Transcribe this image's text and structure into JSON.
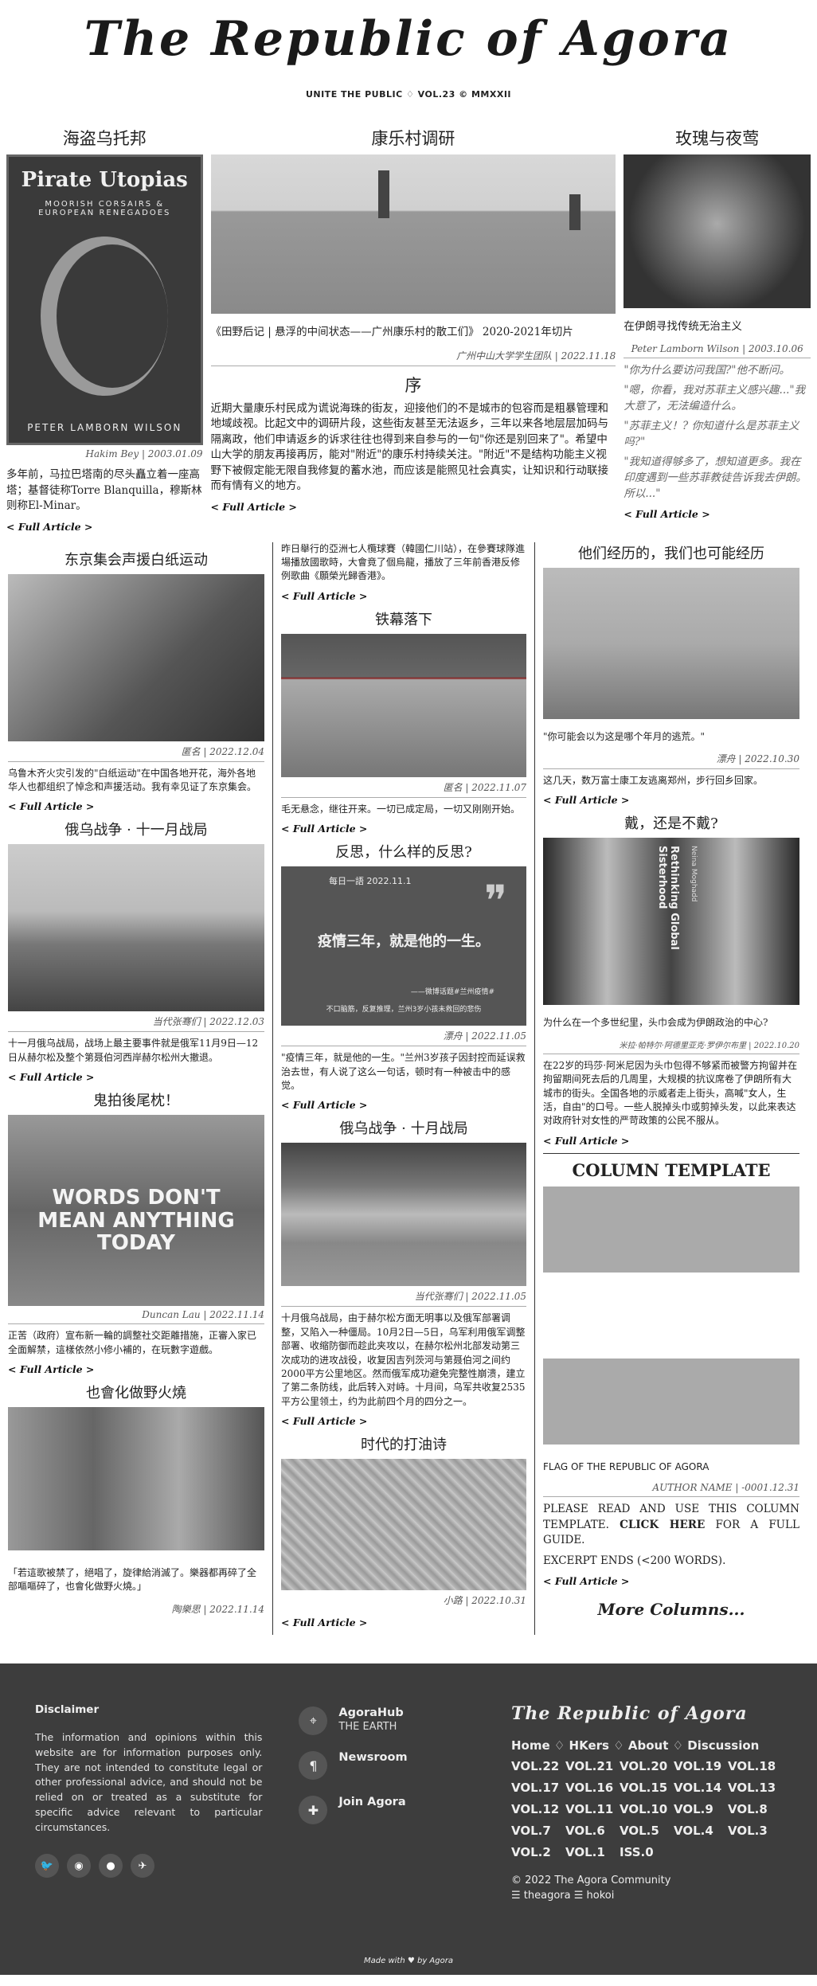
{
  "masthead": {
    "title": "The Republic of Agora",
    "subtitle": "UNITE THE PUBLIC ♢ VOL.23 © MMXXII"
  },
  "top": {
    "left": {
      "title": "海盗乌托邦",
      "image_text": "Pirate Utopias",
      "image_sub": "MOORISH CORSAIRS & EUROPEAN RENEGADOES",
      "image_author": "PETER LAMBORN WILSON",
      "byline": "Hakim Bey | 2003.01.09",
      "text": "多年前，马拉巴塔南的尽头矗立着一座高塔；基督徒称Torre Blanquilla，穆斯林则称El-Minar。",
      "more": "< Full Article >"
    },
    "center": {
      "title": "康乐村调研",
      "caption": "《田野后记 | 悬浮的中间状态——广州康乐村的散工们》 2020-2021年切片",
      "byline": "广州中山大学学生团队 | 2022.11.18",
      "subtitle": "序",
      "text": "近期大量康乐村民成为谎说海珠的街友，迎接他们的不是城市的包容而是粗暴管理和地域歧视。比起文中的调研片段，这些街友甚至无法返乡，三年以来各地层层加码与隔离政，他们申请返乡的诉求往往也得到来自参与的一句\"你还是别回来了\"。希望中山大学的朋友再接再厉，能对\"附近\"的康乐村持续关注。\"附近\"不是结构功能主义视野下被假定能无限自我修复的蓄水池，而应该是能照见社会真实，让知识和行动联接而有情有义的地方。",
      "more": "< Full Article >"
    },
    "right": {
      "title": "玫瑰与夜莺",
      "caption": "在伊朗寻找传统无治主义",
      "byline": "Peter Lamborn Wilson | 2003.10.06",
      "quotes": [
        "\"你为什么要访问我国?\"他不断问。",
        "\"嗯，你看，我对苏菲主义感兴趣...\"我大意了，无法编造什么。",
        "\"苏菲主义！? 你知道什么是苏菲主义吗?\"",
        "\"我知道得够多了，想知道更多。我在印度遇到一些苏菲教徒告诉我去伊朗。所以...\""
      ],
      "more": "< Full Article >"
    }
  },
  "articles": {
    "a1": {
      "title": "东京集会声援白纸运动",
      "byline": "匿名 | 2022.12.04",
      "text": "乌鲁木齐火灾引发的\"白纸运动\"在中国各地开花，海外各地华人也都组织了悼念和声援活动。我有幸见证了东京集会。",
      "more": "< Full Article >"
    },
    "a2": {
      "title": "俄乌战争 · 十一月战局",
      "byline": "当代张骞们 | 2022.12.03",
      "text": "十一月俄乌战局，战场上最主要事件就是俄军11月9日—12日从赫尔松及整个第聂伯河西岸赫尔松州大撤退。",
      "more": "< Full Article >"
    },
    "a3": {
      "title": "鬼拍後尾枕！",
      "image_text": "WORDS DON'T MEAN ANYTHING TODAY",
      "byline": "Duncan Lau | 2022.11.14",
      "text": "正苦（政府）宣布新一輪的調整社交距離措施，正審入家已全面解禁，這樣依然小修小補的，在玩數字遊戲。",
      "more": "< Full Article >"
    },
    "a4": {
      "title": "也會化做野火燒",
      "byline": "陶樂思 | 2022.11.14",
      "text": "「若這歌被禁了，絕唱了，旋律給消滅了。樂器都再碎了全部嘔嘔碎了，也會化做野火燒。」"
    },
    "b0": {
      "text": "昨日舉行的亞洲七人欖球賽（韓國仁川站），在參賽球隊進場播放國歌時，大會竟了個烏龍，播放了三年前香港反修例歌曲《願榮光歸香港》。",
      "more": "< Full Article >"
    },
    "b1": {
      "title": "铁幕落下",
      "byline": "匿名 | 2022.11.07",
      "text": "毛无悬念，继往开来。一切已成定局，一切又刚刚开始。",
      "more": "< Full Article >"
    },
    "b2": {
      "title": "反思，什么样的反思?",
      "image_top": "每日一語 2022.11.1",
      "image_main": "疫情三年，就是他的一生。",
      "image_bottom": "——微博话题#兰州疫情#",
      "image_bottom2": "不口脑筋，反复推理，兰州3岁小孩未救回的悲伤",
      "byline": "漂舟 | 2022.11.05",
      "text": "\"疫情三年，就是他的一生。\"兰州3岁孩子因封控而延误救治去世，有人说了这么一句话，顿时有一种被击中的感觉。",
      "more": "< Full Article >"
    },
    "b3": {
      "title": "俄乌战争 · 十月战局",
      "byline": "当代张骞们 | 2022.11.05",
      "text": "十月俄乌战局，由于赫尔松方面无明事以及俄军部署调整，又陷入一种僵局。10月2日—5日，乌军利用俄军调整部署、收缩防御而趁此夹攻以，在赫尔松州北部发动第三次成功的进攻战役，收复因吉列茨河与第聂伯河之间约2000平方公里地区。然而俄军成功避免完整性崩溃，建立了第二条防线，此后转入对峙。十月间，乌军共收复2535平方公里领土，约为此前四个月的四分之一。",
      "more": "< Full Article >"
    },
    "b4": {
      "title": "时代的打油诗",
      "byline": "小路 | 2022.10.31",
      "more": "< Full Article >"
    },
    "c1": {
      "title": "他们经历的，我们也可能经历",
      "caption": "\"你可能会以为这是哪个年月的逃荒。\"",
      "byline": "漂舟 | 2022.10.30",
      "text": "这几天，数万富士康工友逃离郑州，步行回乡回家。",
      "more": "< Full Article >"
    },
    "c2": {
      "title": "戴，还是不戴?",
      "image_text": "Rethinking Global Sisterhood",
      "image_sub": "Neina Moghadd",
      "caption": "为什么在一个多世纪里，头巾会成为伊朗政治的中心?",
      "byline": "米拉·帕特尔·阿德里亚克·罗伊尔布里 | 2022.10.20",
      "text": "在22岁的玛莎·阿米尼因为头巾包得不够紧而被警方拘留并在拘留期间死去后的几周里，大规模的抗议席卷了伊朗所有大城市的街头。全国各地的示威者走上街头，高喊\"女人，生活，自由\"的口号。一些人脱掉头巾或剪掉头发，以此来表达对政府针对女性的严苛政策的公民不服从。",
      "more": "< Full Article >"
    },
    "c3": {
      "title": "COLUMN TEMPLATE",
      "flag": "FLAG OF THE REPUBLIC OF AGORA",
      "byline": "AUTHOR NAME | -0001.12.31",
      "text_pre": "PLEASE READ AND USE THIS COLUMN TEMPLATE. ",
      "text_link": "CLICK HERE",
      "text_post": " FOR A FULL GUIDE.",
      "excerpt": "EXCERPT ENDS (<200 WORDS).",
      "more": "< Full Article >"
    },
    "more_columns": "More Columns..."
  },
  "footer": {
    "disclaimer_title": "Disclaimer",
    "disclaimer": "The information and opinions within this website are for information purposes only. They are not intended to constitute legal or other professional advice, and should not be relied on or treated as a substitute for specific advice relevant to particular circumstances.",
    "links": [
      {
        "title": "AgoraHub",
        "sub": "THE EARTH",
        "icon": "location-icon"
      },
      {
        "title": "Newsroom",
        "sub": "",
        "icon": "paragraph-icon"
      },
      {
        "title": "Join Agora",
        "sub": "",
        "icon": "puzzle-icon"
      }
    ],
    "brand": "The Republic of Agora",
    "nav": "Home ♢ HKers ♢ About ♢ Discussion",
    "volumes": [
      "VOL.22",
      "VOL.21",
      "VOL.20",
      "VOL.19",
      "VOL.18",
      "VOL.17",
      "VOL.16",
      "VOL.15",
      "VOL.14",
      "VOL.13",
      "VOL.12",
      "VOL.11",
      "VOL.10",
      "VOL.9",
      "VOL.8",
      "VOL.7",
      "VOL.6",
      "VOL.5",
      "VOL.4",
      "VOL.3",
      "VOL.2",
      "VOL.1",
      "ISS.0"
    ],
    "copyright": "© 2022 The Agora Community",
    "credits": "☰ theagora ☰ hokoi",
    "made_with": "Made with ♥ by Agora"
  }
}
